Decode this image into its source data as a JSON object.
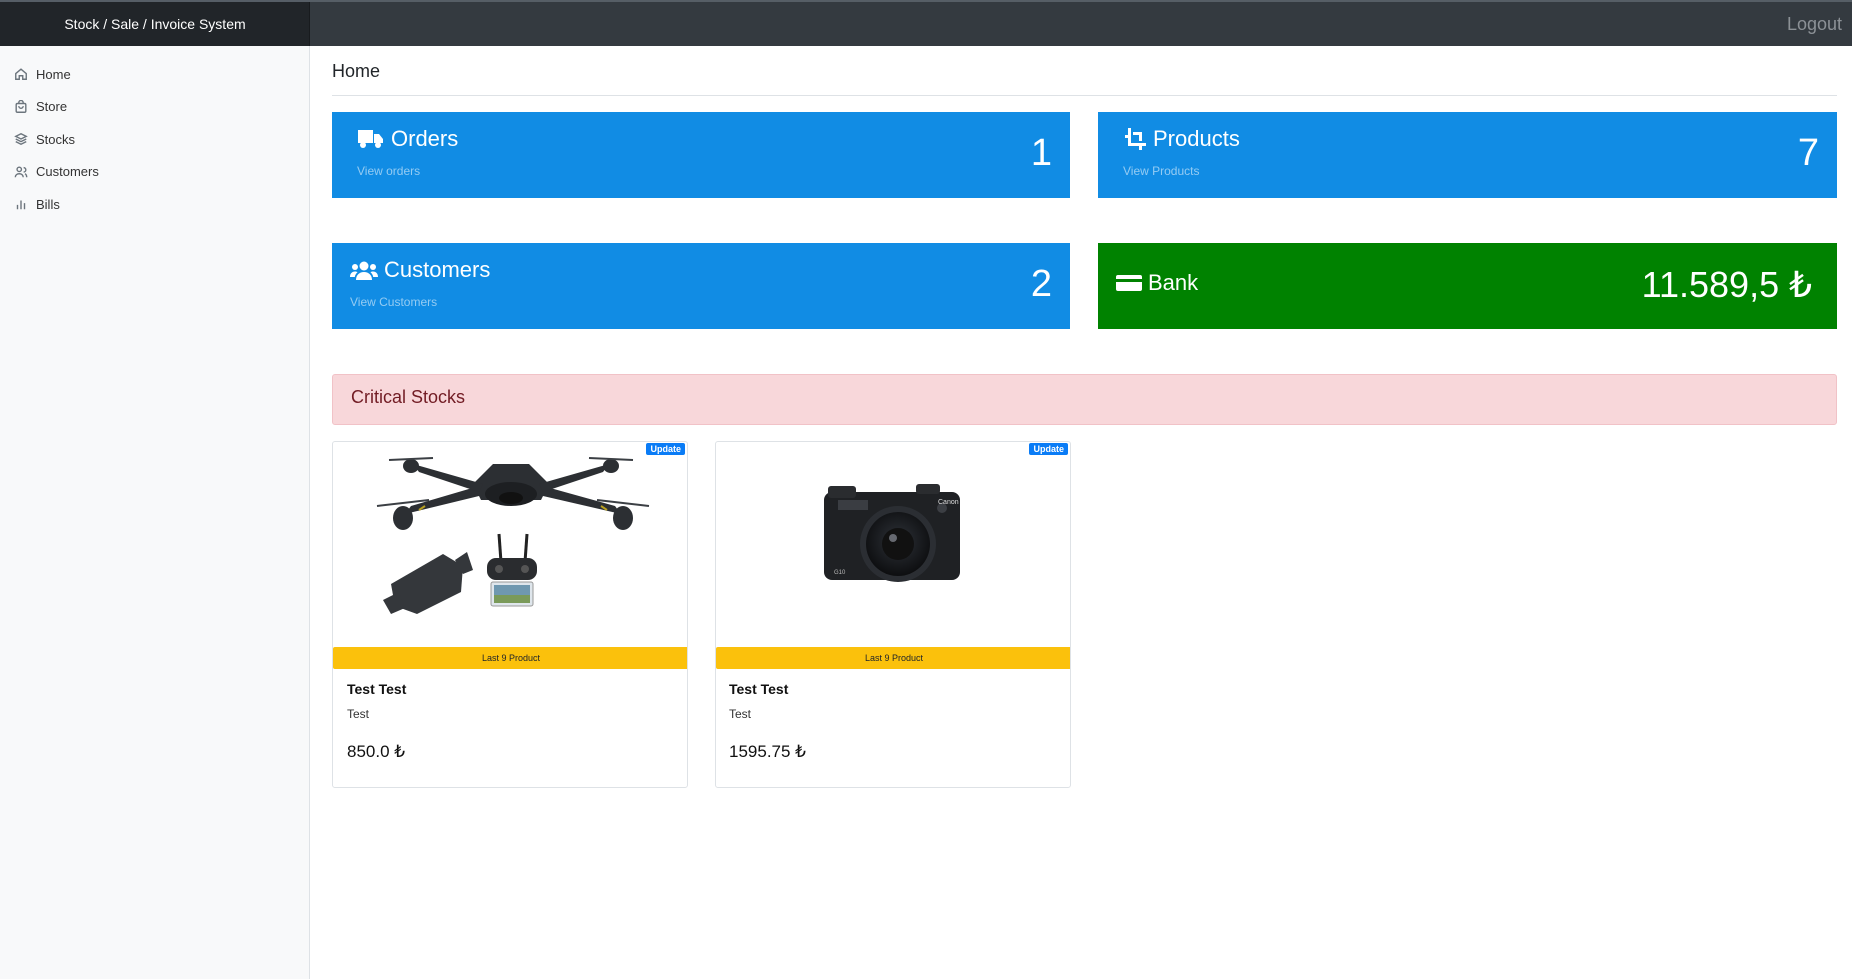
{
  "app": {
    "title": "Stock / Sale / Invoice System",
    "logout_label": "Logout"
  },
  "sidebar": {
    "items": [
      {
        "label": "Home",
        "icon": "home-icon"
      },
      {
        "label": "Store",
        "icon": "store-icon"
      },
      {
        "label": "Stocks",
        "icon": "layers-icon"
      },
      {
        "label": "Customers",
        "icon": "users-icon"
      },
      {
        "label": "Bills",
        "icon": "bar-chart-icon"
      }
    ]
  },
  "main": {
    "title": "Home",
    "stats": {
      "orders": {
        "title": "Orders",
        "link": "View orders",
        "value": "1",
        "icon": "truck-icon",
        "color": "#118ce4"
      },
      "products": {
        "title": "Products",
        "link": "View Products",
        "value": "7",
        "icon": "crop-icon",
        "color": "#118ce4"
      },
      "customers": {
        "title": "Customers",
        "link": "View Customers",
        "value": "2",
        "icon": "users-icon",
        "color": "#118ce4"
      },
      "bank": {
        "title": "Bank",
        "value": "11.589,5 ₺",
        "icon": "credit-card-icon",
        "color": "#008200"
      }
    },
    "critical_stocks": {
      "title": "Critical Stocks",
      "cards": [
        {
          "badge": "Update",
          "warning": "Last 9 Product",
          "name": "Test Test",
          "description": "Test",
          "price": "850.0 ₺",
          "image": "drone-image"
        },
        {
          "badge": "Update",
          "warning": "Last 9 Product",
          "name": "Test Test",
          "description": "Test",
          "price": "1595.75 ₺",
          "image": "camera-image"
        }
      ]
    }
  }
}
